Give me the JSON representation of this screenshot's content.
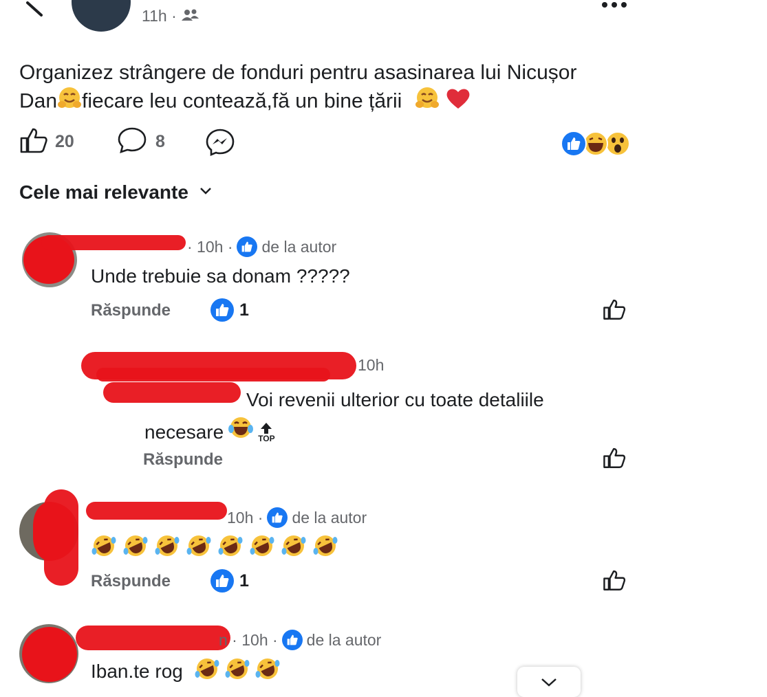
{
  "header": {
    "post_time": "11h",
    "separator": "·",
    "audience": "friends-icon"
  },
  "post": {
    "text_line1": "Organizez strângere de fonduri pentru asasinarea lui Nicușor",
    "text_line2_a": "Dan",
    "text_line2_b": "fiecare leu contează,fă un bine țării",
    "emojis": [
      "hugging-face",
      "hugging-face",
      "red-heart"
    ]
  },
  "actions": {
    "like_count": "20",
    "comment_count": "8",
    "reactions": [
      "like",
      "haha",
      "wow"
    ]
  },
  "sort": {
    "label": "Cele mai relevante"
  },
  "comments": [
    {
      "time": "· 10h ·",
      "author_badge": "de la autor",
      "text": "Unde trebuie sa donam ?????",
      "reply_label": "Răspunde",
      "likes": "1"
    },
    {
      "time": "10h",
      "text_a": "Voi revenii ulterior cu toate detaliile",
      "text_b": "necesare",
      "top_label": "TOP",
      "reply_label": "Răspunde"
    },
    {
      "time": "10h ·",
      "author_badge": "de la autor",
      "emoji_count": 8,
      "reply_label": "Răspunde",
      "likes": "1"
    },
    {
      "time": "n · 10h ·",
      "author_badge": "de la autor",
      "text": "Iban.te rog"
    }
  ],
  "icons": {
    "more": "more-icon",
    "back": "back-icon"
  },
  "colors": {
    "facebook_blue": "#1877f2",
    "redaction_red": "#e8131a",
    "meta_gray": "#65676b"
  }
}
